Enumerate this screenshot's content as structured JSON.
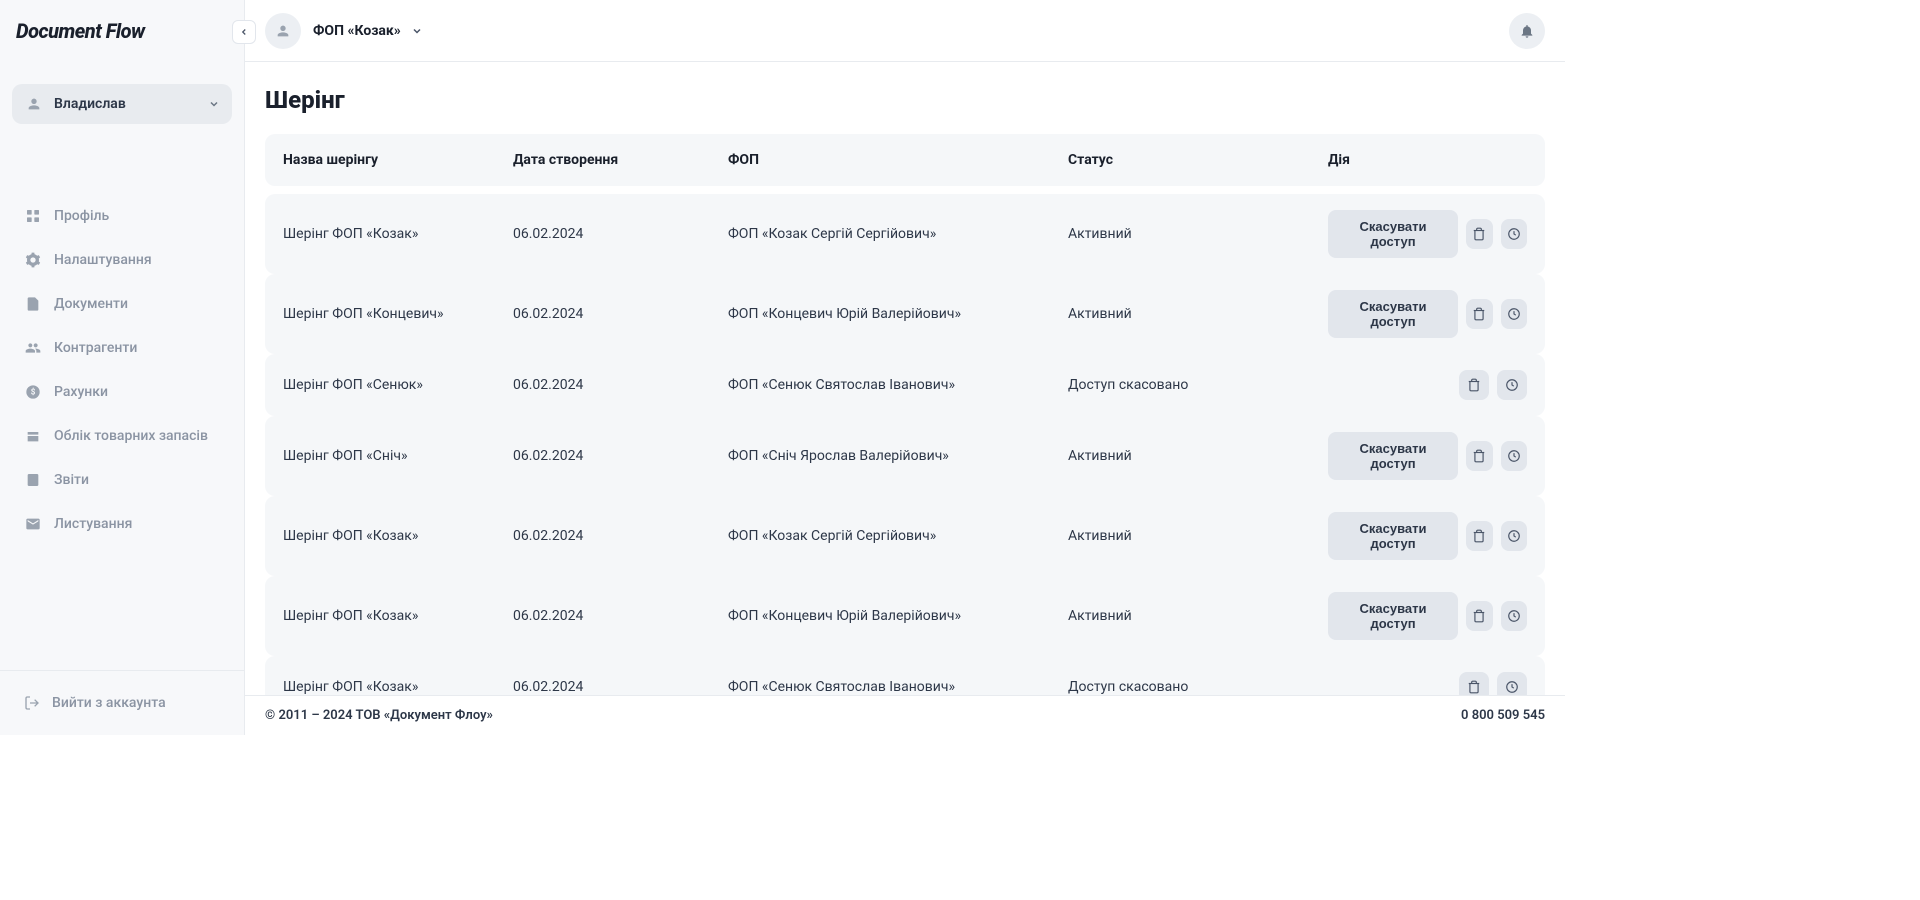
{
  "brand": "Document Flow",
  "user": {
    "name": "Владислав"
  },
  "nav": {
    "profile": "Профіль",
    "settings": "Налаштування",
    "documents": "Документи",
    "counterparties": "Контрагенти",
    "accounts": "Рахунки",
    "inventory": "Облік товарних запасів",
    "reports": "Звіти",
    "correspondence": "Листування"
  },
  "logout": "Вийти з аккаунта",
  "topbar": {
    "org_name": "ФОП «Козак»"
  },
  "page": {
    "title": "Шерінг"
  },
  "table": {
    "headers": {
      "name": "Назва шерінгу",
      "date": "Дата створення",
      "fop": "ФОП",
      "status": "Статус",
      "action": "Дія"
    },
    "cancel_label": "Скасувати доступ",
    "rows": [
      {
        "name": "Шерінг ФОП «Козак»",
        "date": "06.02.2024",
        "fop": "ФОП «Козак Сергій Сергійович»",
        "status": "Активний",
        "cancellable": true
      },
      {
        "name": "Шерінг ФОП «Концевич»",
        "date": "06.02.2024",
        "fop": "ФОП «Концевич Юрій Валерійович»",
        "status": "Активний",
        "cancellable": true
      },
      {
        "name": "Шерінг ФОП «Сенюк»",
        "date": "06.02.2024",
        "fop": "ФОП «Сенюк Святослав Іванович»",
        "status": "Доступ скасовано",
        "cancellable": false
      },
      {
        "name": "Шерінг ФОП «Сніч»",
        "date": "06.02.2024",
        "fop": "ФОП «Сніч Ярослав Валерійович»",
        "status": "Активний",
        "cancellable": true
      },
      {
        "name": "Шерінг ФОП «Козак»",
        "date": "06.02.2024",
        "fop": "ФОП «Козак Сергій Сергійович»",
        "status": "Активний",
        "cancellable": true
      },
      {
        "name": "Шерінг ФОП «Козак»",
        "date": "06.02.2024",
        "fop": "ФОП «Концевич Юрій Валерійович»",
        "status": "Активний",
        "cancellable": true
      },
      {
        "name": "Шерінг ФОП «Козак»",
        "date": "06.02.2024",
        "fop": "ФОП «Сенюк Святослав Іванович»",
        "status": "Доступ скасовано",
        "cancellable": false
      }
    ]
  },
  "footer": {
    "copyright": "© 2011 – 2024 ТОВ «Документ Флоу»",
    "phone": "0 800 509 545"
  }
}
